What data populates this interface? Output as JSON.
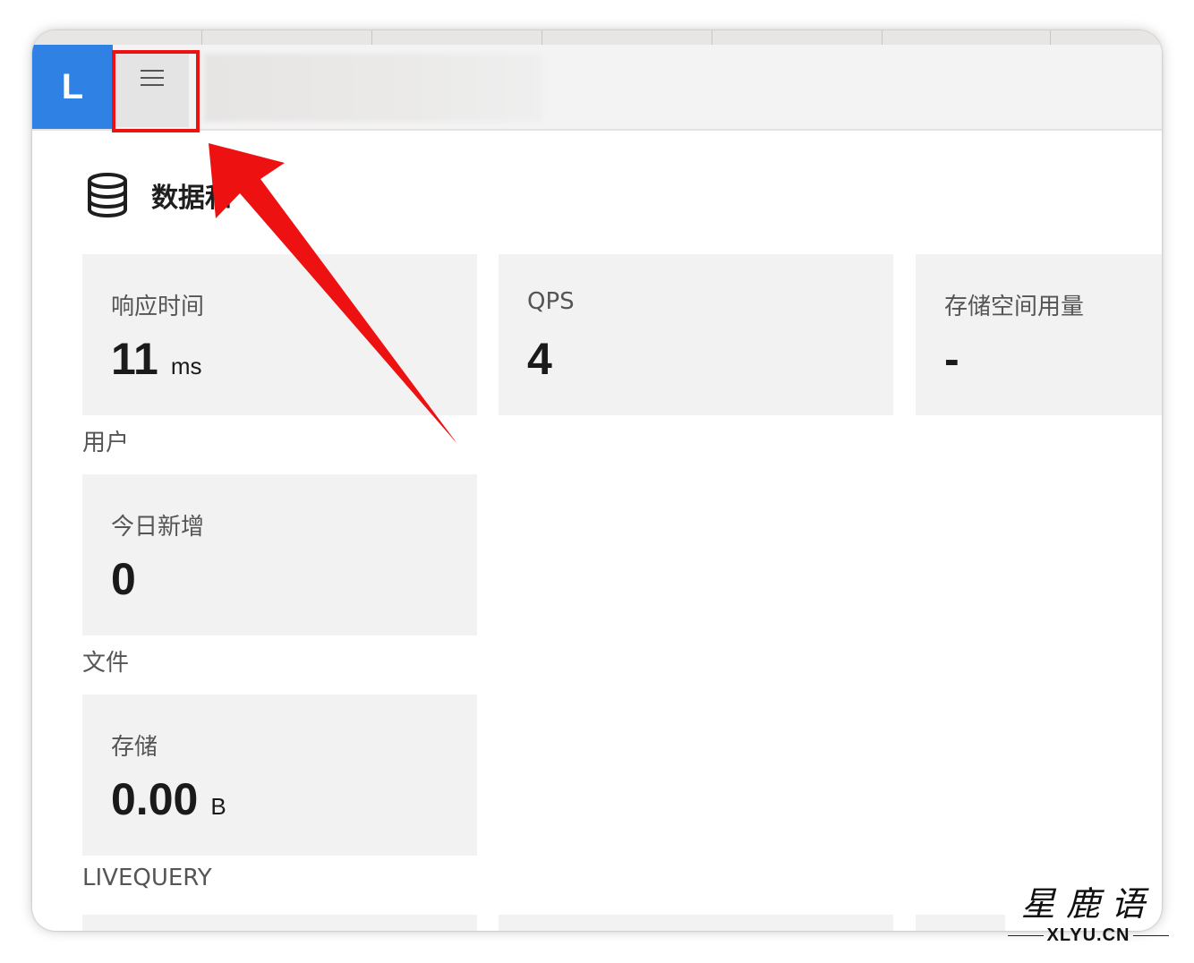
{
  "app": {
    "logo_letter": "L"
  },
  "header": {
    "menu_icon": "hamburger-menu-icon"
  },
  "section": {
    "title": "数据和",
    "icon": "database-icon"
  },
  "cards": {
    "response_time": {
      "label": "响应时间",
      "value": "11",
      "unit": "ms"
    },
    "qps": {
      "label": "QPS",
      "value": "4",
      "unit": ""
    },
    "storage_usage": {
      "label": "存储空间用量",
      "value": "-",
      "unit": ""
    },
    "new_today": {
      "label": "今日新增",
      "value": "0",
      "unit": ""
    },
    "file_storage": {
      "label": "存储",
      "value": "0.00",
      "unit": "B"
    }
  },
  "groups": {
    "users": "用户",
    "files": "文件",
    "livequery": "LIVEQUERY"
  },
  "watermark": {
    "cn": "星鹿语",
    "en": "XLYU.CN"
  },
  "colors": {
    "brand": "#2f82e4",
    "highlight": "#ee1111",
    "card_bg": "#f2f2f2"
  }
}
